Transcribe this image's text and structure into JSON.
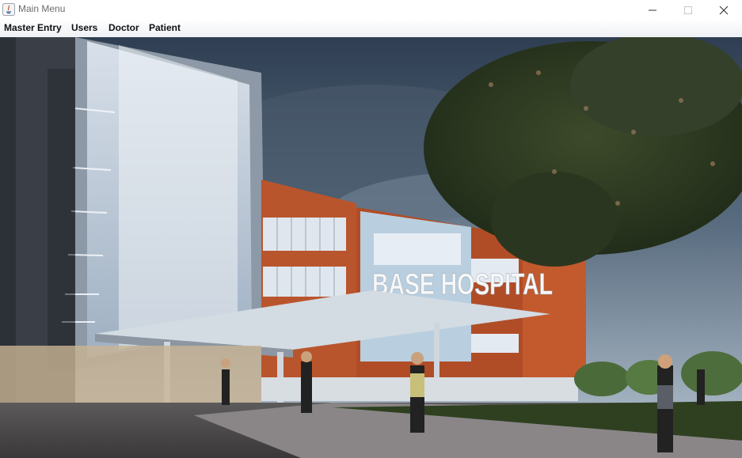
{
  "window": {
    "title": "Main Menu"
  },
  "menubar": {
    "items": [
      {
        "label": "Master Entry"
      },
      {
        "label": "Users"
      },
      {
        "label": "Doctor"
      },
      {
        "label": "Patient"
      }
    ]
  },
  "image": {
    "sign_text": "BASE HOSPITAL"
  },
  "colors": {
    "sky_dark": "#2f3e52",
    "facade_orange": "#b9552c",
    "glass": "#c9d6e3"
  },
  "icons": [
    "java-app-icon",
    "minimize-icon",
    "maximize-icon",
    "close-icon"
  ]
}
